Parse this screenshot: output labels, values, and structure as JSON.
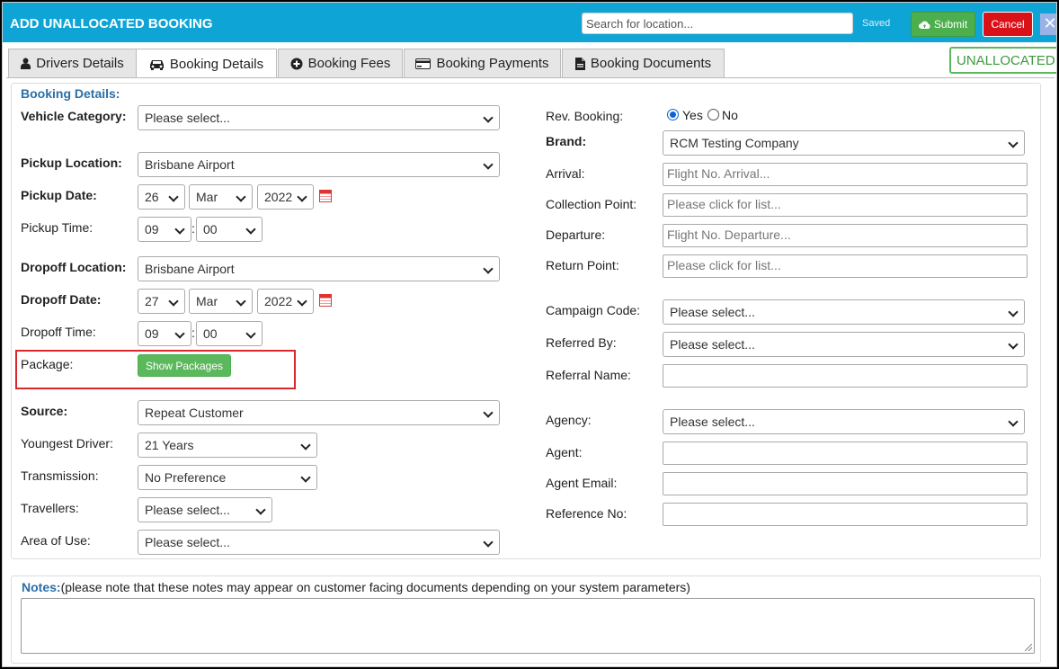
{
  "window": {
    "title": "ADD UNALLOCATED BOOKING",
    "search_placeholder": "Search for location...",
    "saved_text": "Saved",
    "submit_label": "Submit",
    "cancel_label": "Cancel",
    "close_glyph": "✕",
    "accent_color": "#0ea5d6"
  },
  "tabs": [
    {
      "label": "Drivers Details",
      "icon": "user-icon",
      "active": false
    },
    {
      "label": "Booking Details",
      "icon": "car-icon",
      "active": true
    },
    {
      "label": "Booking Fees",
      "icon": "plus-circle-icon",
      "active": false
    },
    {
      "label": "Booking Payments",
      "icon": "credit-card-icon",
      "active": false
    },
    {
      "label": "Booking Documents",
      "icon": "document-icon",
      "active": false
    }
  ],
  "status_badge": "UNALLOCATED",
  "form": {
    "section_title": "Booking Details:",
    "left": {
      "vehicle_category": {
        "label": "Vehicle Category:",
        "value": "Please select..."
      },
      "pickup_location": {
        "label": "Pickup Location:",
        "value": "Brisbane Airport"
      },
      "pickup_date": {
        "label": "Pickup Date:",
        "day": "26",
        "month": "Mar",
        "year": "2022"
      },
      "pickup_time": {
        "label": "Pickup Time:",
        "hour": "09",
        "minute": "00"
      },
      "dropoff_location": {
        "label": "Dropoff Location:",
        "value": "Brisbane Airport"
      },
      "dropoff_date": {
        "label": "Dropoff Date:",
        "day": "27",
        "month": "Mar",
        "year": "2022"
      },
      "dropoff_time": {
        "label": "Dropoff Time:",
        "hour": "09",
        "minute": "00"
      },
      "package": {
        "label": "Package:",
        "button": "Show Packages"
      },
      "source": {
        "label": "Source:",
        "value": "Repeat Customer"
      },
      "youngest_driver": {
        "label": "Youngest Driver:",
        "value": "21 Years"
      },
      "transmission": {
        "label": "Transmission:",
        "value": "No Preference"
      },
      "travellers": {
        "label": "Travellers:",
        "value": "Please select..."
      },
      "area_of_use": {
        "label": "Area of Use:",
        "value": "Please select..."
      }
    },
    "right": {
      "rev_booking": {
        "label": "Rev. Booking:",
        "yes": "Yes",
        "no": "No",
        "selected": "Yes"
      },
      "brand": {
        "label": "Brand:",
        "value": "RCM Testing Company"
      },
      "arrival": {
        "label": "Arrival:",
        "placeholder": "Flight No. Arrival..."
      },
      "collection_point": {
        "label": "Collection Point:",
        "placeholder": "Please click for list..."
      },
      "departure": {
        "label": "Departure:",
        "placeholder": "Flight No. Departure..."
      },
      "return_point": {
        "label": "Return Point:",
        "placeholder": "Please click for list..."
      },
      "campaign_code": {
        "label": "Campaign Code:",
        "value": "Please select..."
      },
      "referred_by": {
        "label": "Referred By:",
        "value": "Please select..."
      },
      "referral_name": {
        "label": "Referral Name:",
        "value": ""
      },
      "agency": {
        "label": "Agency:",
        "value": "Please select..."
      },
      "agent": {
        "label": "Agent:",
        "value": ""
      },
      "agent_email": {
        "label": "Agent Email:",
        "value": ""
      },
      "reference_no": {
        "label": "Reference No:",
        "value": ""
      }
    }
  },
  "notes": {
    "title": "Notes:",
    "hint": "(please note that these notes may appear on customer facing documents depending on your system parameters)",
    "value": ""
  }
}
